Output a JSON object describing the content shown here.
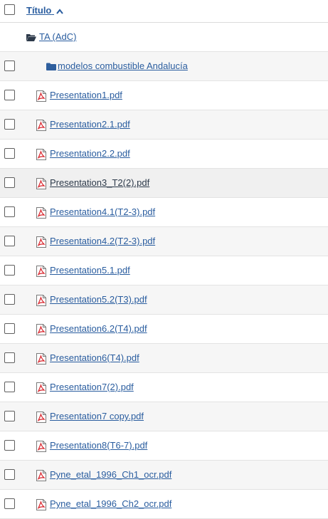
{
  "header": {
    "title_label": "Título"
  },
  "parent_folder": {
    "label": "TA (AdC)"
  },
  "subfolder": {
    "label": "modelos combustible Andalucía"
  },
  "files": [
    {
      "label": "Presentation1.pdf"
    },
    {
      "label": "Presentation2.1.pdf"
    },
    {
      "label": "Presentation2.2.pdf"
    },
    {
      "label": "Presentation3_T2(2).pdf"
    },
    {
      "label": "Presentation4.1(T2-3).pdf"
    },
    {
      "label": "Presentation4.2(T2-3).pdf"
    },
    {
      "label": "Presentation5.1.pdf"
    },
    {
      "label": "Presentation5.2(T3).pdf"
    },
    {
      "label": "Presentation6.2(T4).pdf"
    },
    {
      "label": "Presentation6(T4).pdf"
    },
    {
      "label": "Presentation7(2).pdf"
    },
    {
      "label": "Presentation7 copy.pdf"
    },
    {
      "label": "Presentation8(T6-7).pdf"
    },
    {
      "label": "Pyne_etal_1996_Ch1_ocr.pdf"
    },
    {
      "label": "Pyne_etal_1996_Ch2_ocr.pdf"
    }
  ],
  "icons": {
    "sort": "caret-up-icon",
    "parent_folder": "folder-open-icon",
    "subfolder": "folder-icon",
    "file": "pdf-file-icon"
  },
  "colors": {
    "link": "#2a5d9f",
    "pdf_red": "#d8232a",
    "folder": "#2f5f9e"
  }
}
